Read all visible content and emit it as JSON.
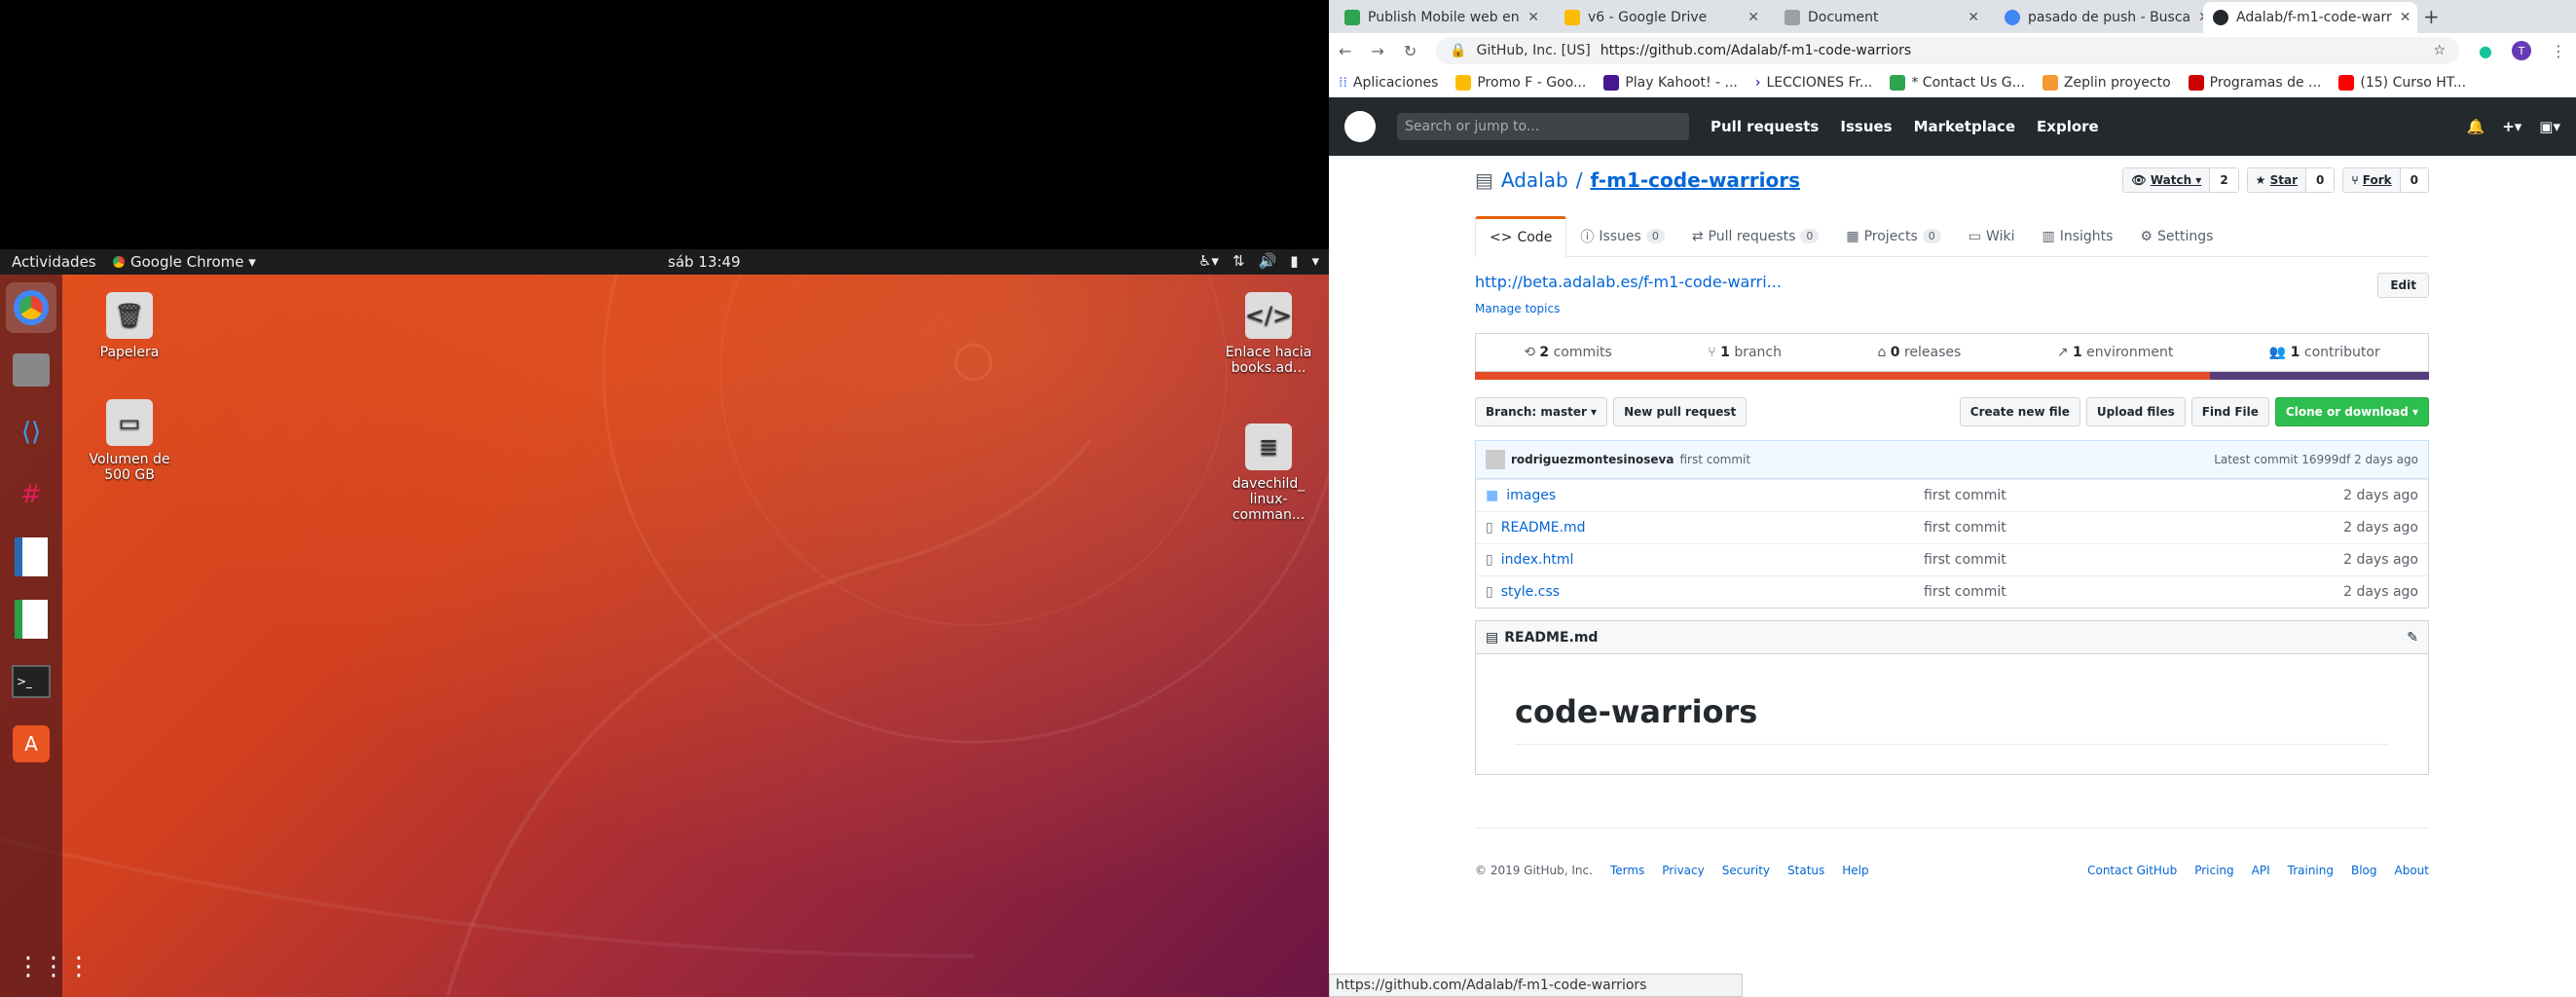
{
  "desktop": {
    "activities": "Actividades",
    "app_menu": "Google Chrome ▾",
    "clock": "sáb 13:49",
    "icons": [
      {
        "label": "Papelera",
        "icon": "trash-icon"
      },
      {
        "label": "Volumen de 500 GB",
        "icon": "drive-icon"
      },
      {
        "label": "Enlace hacia books.ad...",
        "icon": "html-file-icon"
      },
      {
        "label": "davechild_ linux- comman...",
        "icon": "document-icon"
      }
    ]
  },
  "browser": {
    "tabs": [
      {
        "title": "Publish Mobile web en",
        "color": "#2ea44f"
      },
      {
        "title": "v6 - Google Drive",
        "color": "#fbbc04"
      },
      {
        "title": "Document",
        "color": "#9aa0a6"
      },
      {
        "title": "pasado de push - Busca",
        "color": "#4285f4"
      },
      {
        "title": "Adalab/f-m1-code-warr",
        "color": "#24292e"
      }
    ],
    "new_tab": "+",
    "url_org": "GitHub, Inc. [US]",
    "url": "https://github.com/Adalab/f-m1-code-warriors",
    "bookmarks": [
      "Aplicaciones",
      "Promo F - Goo...",
      "Play Kahoot! - ...",
      "LECCIONES Fr...",
      "* Contact Us G...",
      "Zeplin proyecto",
      "Programas de ...",
      "(15) Curso HT..."
    ],
    "status_url": "https://github.com/Adalab/f-m1-code-warriors"
  },
  "github": {
    "search_placeholder": "Search or jump to...",
    "nav": [
      "Pull requests",
      "Issues",
      "Marketplace",
      "Explore"
    ],
    "owner": "Adalab",
    "repo": "f-m1-code-warriors",
    "watch": "Watch ▾",
    "watch_count": "2",
    "star": "Star",
    "star_count": "0",
    "fork": "Fork",
    "fork_count": "0",
    "tabs": [
      {
        "label": "Code",
        "count": ""
      },
      {
        "label": "Issues",
        "count": "0"
      },
      {
        "label": "Pull requests",
        "count": "0"
      },
      {
        "label": "Projects",
        "count": "0"
      },
      {
        "label": "Wiki",
        "count": ""
      },
      {
        "label": "Insights",
        "count": ""
      },
      {
        "label": "Settings",
        "count": ""
      }
    ],
    "homepage": "http://beta.adalab.es/f-m1-code-warri...",
    "edit": "Edit",
    "manage_topics": "Manage topics",
    "stats": [
      {
        "n": "2",
        "label": "commits"
      },
      {
        "n": "1",
        "label": "branch"
      },
      {
        "n": "0",
        "label": "releases"
      },
      {
        "n": "1",
        "label": "environment"
      },
      {
        "n": "1",
        "label": "contributor"
      }
    ],
    "lang_colors": [
      "#e34c26",
      "#563d7c"
    ],
    "branch": "Branch: master ▾",
    "new_pr": "New pull request",
    "create_file": "Create new file",
    "upload": "Upload files",
    "find": "Find File",
    "clone": "Clone or download ▾",
    "commit_author": "rodriguezmontesinoseva",
    "commit_msg": "first commit",
    "latest_commit": "Latest commit 16999df 2 days ago",
    "files": [
      {
        "name": "images",
        "msg": "first commit",
        "age": "2 days ago",
        "icon": "folder-icon"
      },
      {
        "name": "README.md",
        "msg": "first commit",
        "age": "2 days ago",
        "icon": "file-icon"
      },
      {
        "name": "index.html",
        "msg": "first commit",
        "age": "2 days ago",
        "icon": "file-icon"
      },
      {
        "name": "style.css",
        "msg": "first commit",
        "age": "2 days ago",
        "icon": "file-icon"
      }
    ],
    "readme_title": "README.md",
    "readme_h1": "code-warriors",
    "footer_copy": "© 2019 GitHub, Inc.",
    "footer_left": [
      "Terms",
      "Privacy",
      "Security",
      "Status",
      "Help"
    ],
    "footer_right": [
      "Contact GitHub",
      "Pricing",
      "API",
      "Training",
      "Blog",
      "About"
    ]
  }
}
